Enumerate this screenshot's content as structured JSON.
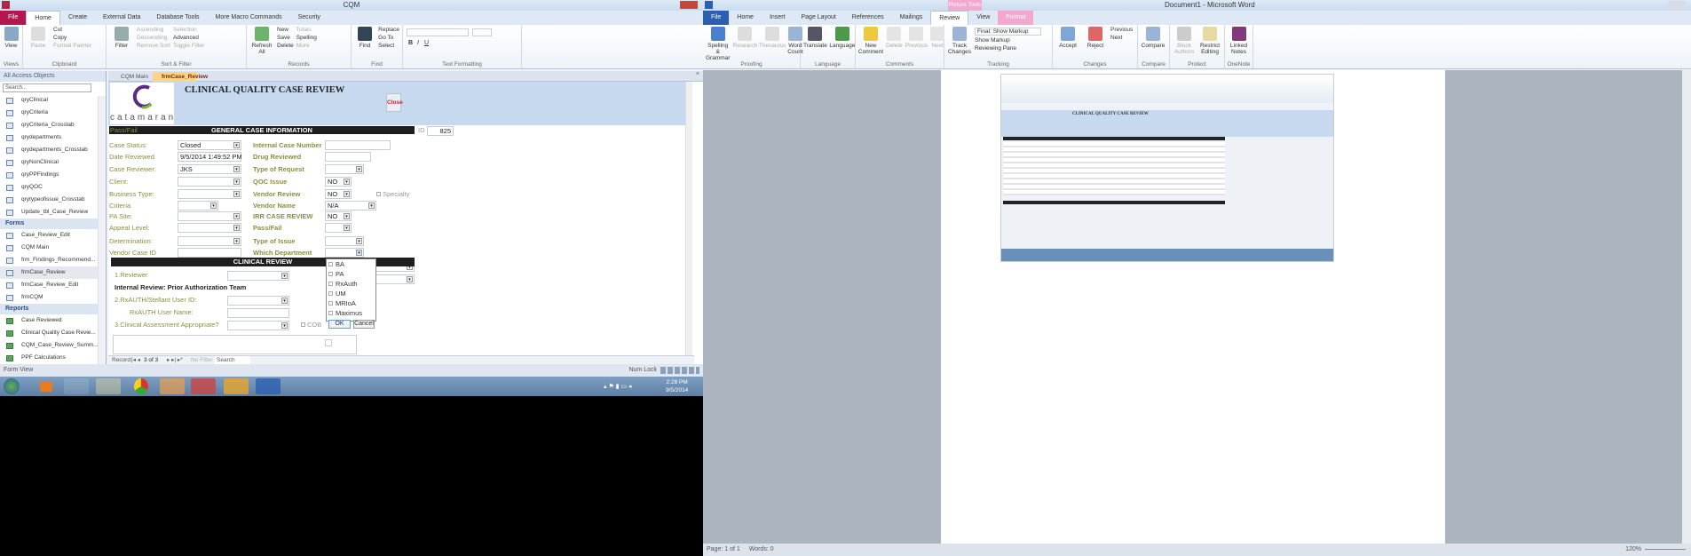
{
  "access": {
    "title": "CQM",
    "tabs": [
      "File",
      "Home",
      "Create",
      "External Data",
      "Database Tools",
      "More Macro Commands",
      "Security"
    ],
    "ribbon": {
      "views": {
        "label": "Views",
        "view": "View"
      },
      "clipboard": {
        "label": "Clipboard",
        "paste": "Paste",
        "cut": "Cut",
        "copy": "Copy",
        "format_painter": "Format Painter"
      },
      "sort_filter": {
        "label": "Sort & Filter",
        "filter": "Filter",
        "ascending": "Ascending",
        "descending": "Descending",
        "remove_sort": "Remove Sort",
        "selection": "Selection",
        "advanced": "Advanced",
        "toggle_filter": "Toggle Filter"
      },
      "records": {
        "label": "Records",
        "refresh": "Refresh All",
        "new": "New",
        "save": "Save",
        "delete": "Delete",
        "totals": "Totals",
        "spelling": "Spelling",
        "more": "More"
      },
      "find": {
        "label": "Find",
        "find": "Find",
        "replace": "Replace",
        "goto": "Go To",
        "select": "Select"
      },
      "text_formatting": {
        "label": "Text Formatting"
      }
    },
    "nav": {
      "header": "All Access Objects",
      "search_placeholder": "Search...",
      "queries": [
        "qryClinical",
        "qryCriteria",
        "qryCriteria_Crosstab",
        "qrydepartments",
        "qrydepartments_Crosstab",
        "qryNonClinical",
        "qryPPFindings",
        "qryQOC",
        "qrytypeofissue_Crosstab",
        "Update_tbl_Case_Review"
      ],
      "forms_label": "Forms",
      "forms": [
        "Case_Review_Edit",
        "CQM Main",
        "frm_Findings_Recommend...",
        "frmCase_Review",
        "frmCase_Review_Edit",
        "frmCQM"
      ],
      "reports_label": "Reports",
      "reports": [
        "Case Reviewed",
        "Clinical Quality Case Revie...",
        "CQM_Case_Review_Summ...",
        "PPF Calculations"
      ]
    },
    "doc_tabs": [
      "CQM Main",
      "frmCase_Review"
    ],
    "form": {
      "logo_text": "catamaran",
      "title": "CLINICAL QUALITY CASE REVIEW",
      "close": "Close",
      "passfail_header": "Pass/Fail",
      "general_header": "GENERAL CASE INFORMATION",
      "id_label": "ID",
      "id_value": "825",
      "left": [
        {
          "label": "Case Status:",
          "value": "Closed",
          "dd": true
        },
        {
          "label": "Date Reviewed",
          "value": "9/5/2014 1:49:52 PM",
          "dd": false
        },
        {
          "label": "Case Reviewer:",
          "value": "JKS",
          "dd": true
        },
        {
          "label": "Client:",
          "value": "",
          "dd": true
        },
        {
          "label": "Business Type:",
          "value": "",
          "dd": true
        },
        {
          "label": "Criteria",
          "value": "",
          "dd": true
        },
        {
          "label": "PA Site:",
          "value": "",
          "dd": true
        },
        {
          "label": "Appeal Level:",
          "value": "",
          "dd": true
        },
        {
          "label": "Determination:",
          "value": "",
          "dd": true
        },
        {
          "label": "Vendor Case ID",
          "value": "",
          "dd": false
        }
      ],
      "right": [
        {
          "label": "Internal Case Number",
          "value": "",
          "dd": false
        },
        {
          "label": "Drug Reviewed",
          "value": "",
          "dd": false
        },
        {
          "label": "Type of Request",
          "value": "",
          "dd": true
        },
        {
          "label": "QOC Issue",
          "value": "NO",
          "dd": true
        },
        {
          "label": "Vendor Review",
          "value": "NO",
          "dd": true
        },
        {
          "label": "Vendor Name",
          "value": "N/A",
          "dd": true
        },
        {
          "label": "IRR CASE REVIEW",
          "value": "NO",
          "dd": true
        },
        {
          "label": "Pass/Fail",
          "value": "",
          "dd": true
        },
        {
          "label": "Type of Issue",
          "value": "",
          "dd": true
        },
        {
          "label": "Which Department",
          "value": "",
          "dd": true
        }
      ],
      "specialty": "Specialty",
      "clinical_header": "CLINICAL REVIEW",
      "reviewer": "1.Reviewer",
      "internal_review": "Internal Review: Prior Authorization Team",
      "rxauth_id": "2.RxAUTH/Stellant User ID:",
      "rxauth_name": "RxAUTH User Name:",
      "clinical_assessment": "3.Clinical Assessment Appropriate?",
      "cob": "COB",
      "dept_options": [
        "BA",
        "PA",
        "RxAuth",
        "UM",
        "MRIoA",
        "Maximus"
      ],
      "ok": "OK",
      "cancel": "Cancel"
    },
    "record_nav": {
      "label": "Record:",
      "position": "3 of 3",
      "filter": "No Filter",
      "search": "Search"
    },
    "status": {
      "view": "Form View",
      "numlock": "Num Lock"
    }
  },
  "taskbar": {
    "time": "2:28 PM",
    "date": "9/5/2014"
  },
  "word": {
    "title": "Document1 - Microsoft Word",
    "tabs": [
      "File",
      "Home",
      "Insert",
      "Page Layout",
      "References",
      "Mailings",
      "Review",
      "View",
      "Format"
    ],
    "context_tab": "Picture Tools",
    "ribbon": {
      "proofing": {
        "label": "Proofing",
        "spelling": "Spelling & Grammar",
        "research": "Research",
        "thesaurus": "Thesaurus",
        "word_count": "Word Count"
      },
      "language": {
        "label": "Language",
        "translate": "Translate",
        "language": "Language"
      },
      "comments": {
        "label": "Comments",
        "new": "New Comment",
        "delete": "Delete",
        "previous": "Previous",
        "next": "Next"
      },
      "tracking": {
        "label": "Tracking",
        "track": "Track Changes",
        "markup_mode": "Final: Show Markup",
        "show_markup": "Show Markup",
        "reviewing_pane": "Reviewing Pane"
      },
      "changes": {
        "label": "Changes",
        "accept": "Accept",
        "reject": "Reject",
        "previous": "Previous",
        "next": "Next"
      },
      "compare": {
        "label": "Compare",
        "compare": "Compare"
      },
      "protect": {
        "label": "Protect",
        "block": "Block Authors",
        "restrict": "Restrict Editing"
      },
      "onenote": {
        "label": "OneNote",
        "linked": "Linked Notes"
      }
    },
    "status": {
      "page": "Page: 1 of 1",
      "words": "Words: 0",
      "zoom": "120%"
    }
  }
}
